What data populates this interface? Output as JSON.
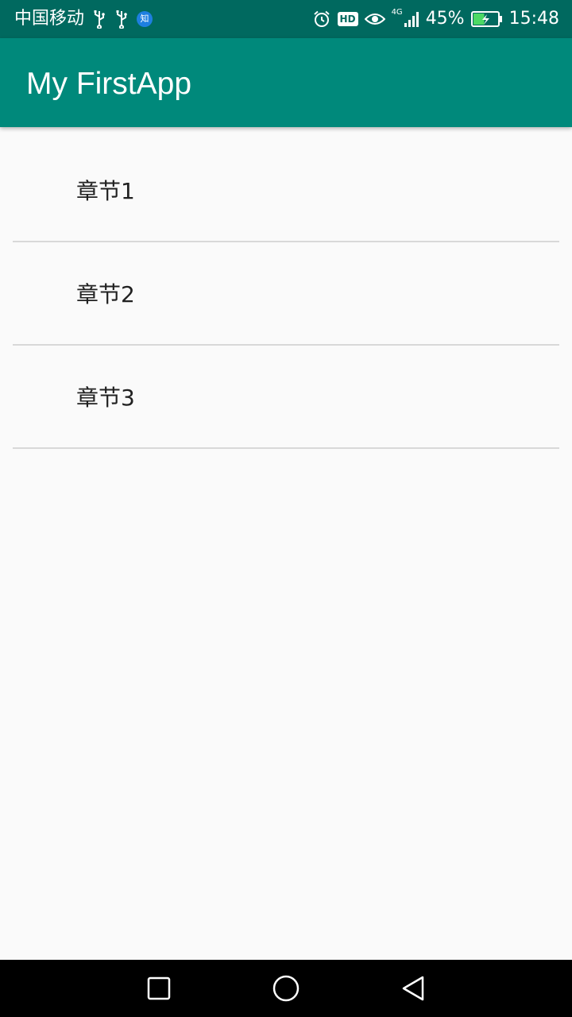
{
  "status_bar": {
    "carrier": "中国移动",
    "notification_icons": [
      "usb-icon",
      "usb-icon",
      "zhihu-icon"
    ],
    "zhihu_glyph": "知",
    "hd_label": "HD",
    "network_label": "4G",
    "battery_percent": "45%",
    "battery_level": 0.45,
    "time": "15:48"
  },
  "app_bar": {
    "title": "My FirstApp",
    "color": "#00897b"
  },
  "list": {
    "items": [
      {
        "label": "章节1"
      },
      {
        "label": "章节2"
      },
      {
        "label": "章节3"
      }
    ]
  },
  "nav_bar": {
    "buttons": [
      "recent-apps-icon",
      "home-icon",
      "back-icon"
    ]
  },
  "colors": {
    "status_bar": "#00695f",
    "accent": "#00897b",
    "background": "#fafafa",
    "divider": "#d8d8d8"
  }
}
